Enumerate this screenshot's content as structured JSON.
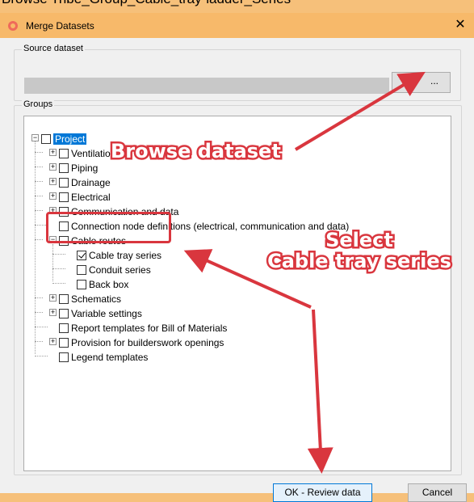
{
  "caption": "Browse Tribe_Group_Cable_tray-ladder_Series",
  "window": {
    "title": "Merge Datasets",
    "close_icon": "close-icon"
  },
  "source": {
    "label": "Source dataset",
    "field_value": "",
    "browse_label": "..."
  },
  "groups": {
    "label": "Groups",
    "items": [
      {
        "label": "Project",
        "checked": false,
        "expander": "minus",
        "selected": true
      },
      {
        "label": "Ventilation",
        "checked": false,
        "expander": "plus"
      },
      {
        "label": "Piping",
        "checked": false,
        "expander": "plus"
      },
      {
        "label": "Drainage",
        "checked": false,
        "expander": "plus"
      },
      {
        "label": "Electrical",
        "checked": false,
        "expander": "plus"
      },
      {
        "label": "Communication and data",
        "checked": false,
        "expander": "plus"
      },
      {
        "label": "Connection node definitions (electrical, communication and data)",
        "checked": false,
        "expander": "none"
      },
      {
        "label": "Cable routes",
        "checked": false,
        "expander": "minus"
      },
      {
        "label": "Cable tray series",
        "checked": true,
        "expander": "none"
      },
      {
        "label": "Conduit series",
        "checked": false,
        "expander": "none"
      },
      {
        "label": "Back box",
        "checked": false,
        "expander": "none"
      },
      {
        "label": "Schematics",
        "checked": false,
        "expander": "plus"
      },
      {
        "label": "Variable settings",
        "checked": false,
        "expander": "plus"
      },
      {
        "label": "Report templates for Bill of Materials",
        "checked": false,
        "expander": "none"
      },
      {
        "label": "Provision for builderswork openings",
        "checked": false,
        "expander": "plus"
      },
      {
        "label": "Legend templates",
        "checked": false,
        "expander": "none"
      }
    ]
  },
  "buttons": {
    "ok": "OK - Review data",
    "cancel": "Cancel"
  },
  "annotations": {
    "browse": "Browse dataset",
    "select_line1": "Select",
    "select_line2": "Cable tray series",
    "color": "#d9363e"
  }
}
